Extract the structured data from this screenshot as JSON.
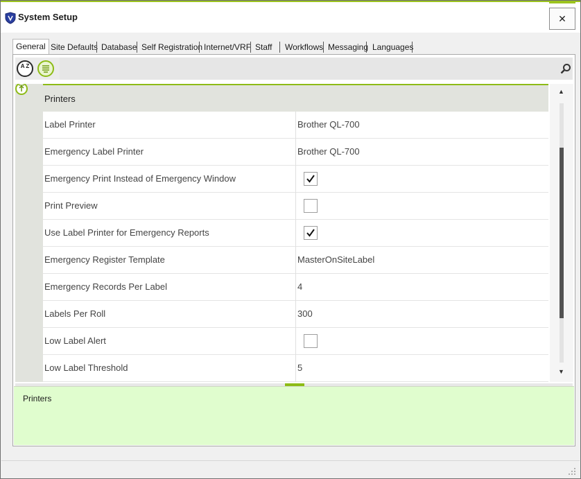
{
  "window": {
    "title": "System Setup",
    "close_label": "✕",
    "accent_color": "#9cc41f"
  },
  "tabs": [
    {
      "label": "General",
      "active": true
    },
    {
      "label": "Site Defaults"
    },
    {
      "label": "Database"
    },
    {
      "label": "Self Registration"
    },
    {
      "label": "Internet/VRF"
    },
    {
      "label": "Staff"
    },
    {
      "label": "Workflows"
    },
    {
      "label": "Messaging"
    },
    {
      "label": "Languages"
    }
  ],
  "toolbar": {
    "sort_alpha_icon": "sort-alphabetical-icon",
    "sort_alpha_text": "A Z",
    "categorized_icon": "categorized-list-icon",
    "search_icon": "search-icon"
  },
  "grid": {
    "category": "Printers",
    "rows": [
      {
        "name": "Label Printer",
        "value": "Brother QL-700"
      },
      {
        "name": "Emergency Label Printer",
        "value": "Brother QL-700"
      },
      {
        "name": "Emergency Print Instead of Emergency Window",
        "checked": true
      },
      {
        "name": "Print Preview",
        "checked": false
      },
      {
        "name": "Use Label Printer for Emergency Reports",
        "checked": true
      },
      {
        "name": "Emergency Register Template",
        "value": "MasterOnSiteLabel"
      },
      {
        "name": "Emergency Records Per Label",
        "value": "4"
      },
      {
        "name": "Labels Per Roll",
        "value": "300"
      },
      {
        "name": "Low Label Alert",
        "checked": false
      },
      {
        "name": "Low Label Threshold",
        "value": "5"
      }
    ]
  },
  "scrollbar": {
    "up_arrow": "▲",
    "down_arrow": "▼"
  },
  "help": {
    "title": "Printers"
  }
}
